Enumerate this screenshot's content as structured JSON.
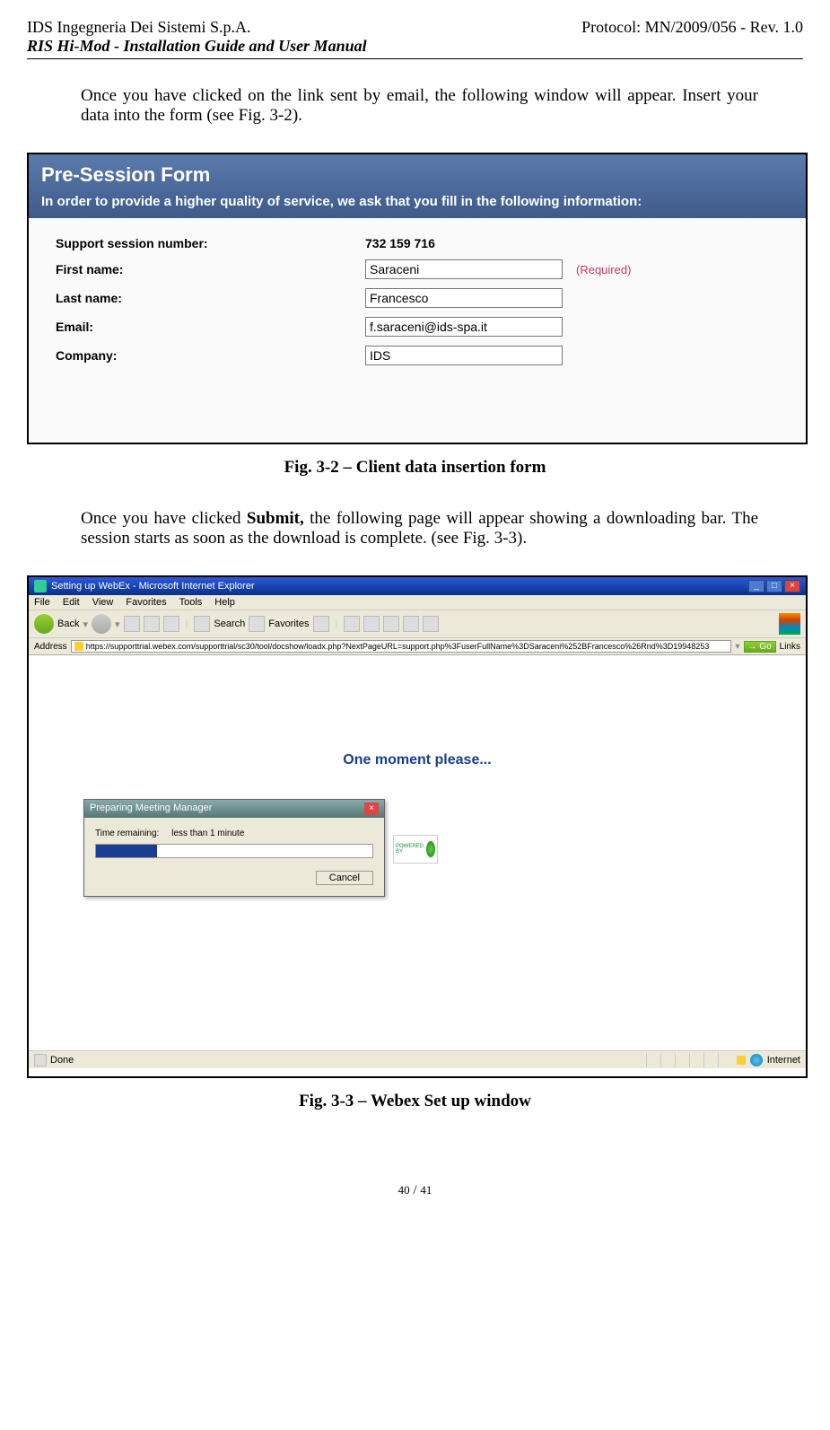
{
  "header": {
    "company": "IDS Ingegneria Dei Sistemi S.p.A.",
    "protocol": "Protocol: MN/2009/056 - Rev. 1.0",
    "subtitle": "RIS Hi-Mod  - Installation Guide and User Manual"
  },
  "paragraph1": "Once you have clicked on the link sent by email, the following window will appear. Insert your data into the form (see Fig. 3-2).",
  "fig32": {
    "header_title": "Pre-Session Form",
    "header_sub": "In order to provide a higher quality of service, we ask that you fill in the following information:",
    "fields": {
      "session_label": "Support session number:",
      "session_value": "732 159 716",
      "first_name_label": "First name:",
      "first_name_value": "Saraceni",
      "required": "(Required)",
      "last_name_label": "Last name:",
      "last_name_value": "Francesco",
      "email_label": "Email:",
      "email_value": "f.saraceni@ids-spa.it",
      "company_label": "Company:",
      "company_value": "IDS"
    }
  },
  "caption1": "Fig. 3-2 – Client data insertion form",
  "paragraph2_a": "Once you have clicked ",
  "paragraph2_b": "Submit,",
  "paragraph2_c": " the following page will appear showing a downloading bar. The session starts as soon as the download is complete. (see Fig. 3-3).",
  "fig33": {
    "title": "Setting up WebEx - Microsoft Internet Explorer",
    "menu": [
      "File",
      "Edit",
      "View",
      "Favorites",
      "Tools",
      "Help"
    ],
    "back_label": "Back",
    "search_label": "Search",
    "favorites_label": "Favorites",
    "address_label": "Address",
    "url": "https://supporttrial.webex.com/supporttrial/sc30/tool/docshow/loadx.php?NextPageURL=support.php%3FuserFullName%3DSaraceni%252BFrancesco%26Rnd%3D19948253",
    "go": "Go",
    "links": "Links",
    "moment": "One moment please...",
    "dialog_title": "Preparing Meeting Manager",
    "time_label": "Time remaining:",
    "time_value": "less than 1 minute",
    "cancel": "Cancel",
    "powered": "POWERED BY",
    "status_done": "Done",
    "status_zone": "Internet"
  },
  "caption2": "Fig. 3-3 – Webex Set up window",
  "footer_page": "40 / 41"
}
